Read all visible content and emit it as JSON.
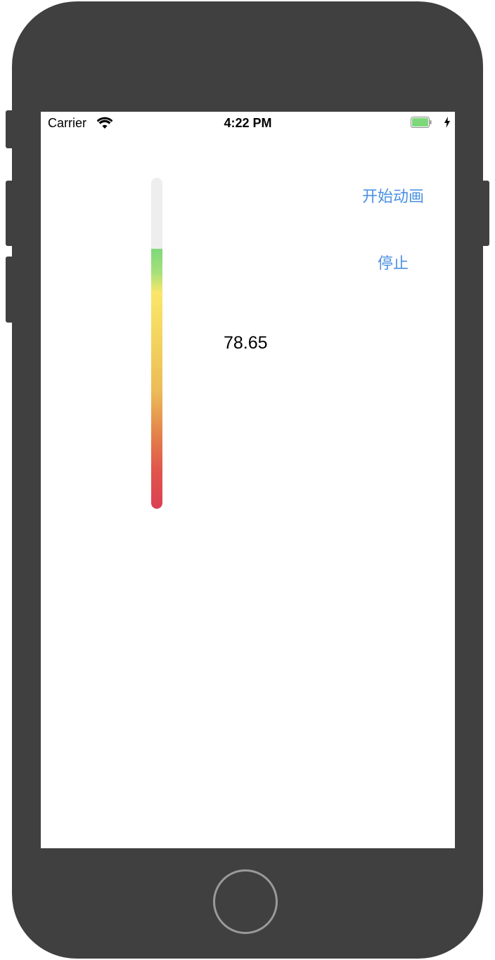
{
  "status_bar": {
    "carrier": "Carrier",
    "time": "4:22 PM",
    "wifi_icon": "wifi-icon",
    "battery_icon": "battery-icon",
    "charging_icon": "bolt-icon"
  },
  "gauge": {
    "value_label": "78.65",
    "fill_fraction": 0.7865,
    "colors": {
      "track": "#eeeeee",
      "bottom": "#db4052",
      "middle": "#ecbb58",
      "top": "#7ed87a"
    }
  },
  "buttons": {
    "start_label": "开始动画",
    "stop_label": "停止",
    "color": "#4a90e2"
  }
}
